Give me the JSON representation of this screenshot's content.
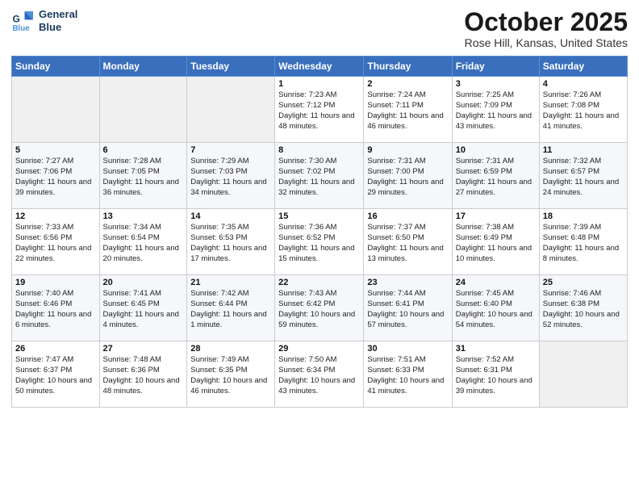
{
  "header": {
    "logo_line1": "General",
    "logo_line2": "Blue",
    "month": "October 2025",
    "location": "Rose Hill, Kansas, United States"
  },
  "days_of_week": [
    "Sunday",
    "Monday",
    "Tuesday",
    "Wednesday",
    "Thursday",
    "Friday",
    "Saturday"
  ],
  "weeks": [
    [
      {
        "day": "",
        "sunrise": "",
        "sunset": "",
        "daylight": ""
      },
      {
        "day": "",
        "sunrise": "",
        "sunset": "",
        "daylight": ""
      },
      {
        "day": "",
        "sunrise": "",
        "sunset": "",
        "daylight": ""
      },
      {
        "day": "1",
        "sunrise": "7:23 AM",
        "sunset": "7:12 PM",
        "daylight": "11 hours and 48 minutes."
      },
      {
        "day": "2",
        "sunrise": "7:24 AM",
        "sunset": "7:11 PM",
        "daylight": "11 hours and 46 minutes."
      },
      {
        "day": "3",
        "sunrise": "7:25 AM",
        "sunset": "7:09 PM",
        "daylight": "11 hours and 43 minutes."
      },
      {
        "day": "4",
        "sunrise": "7:26 AM",
        "sunset": "7:08 PM",
        "daylight": "11 hours and 41 minutes."
      }
    ],
    [
      {
        "day": "5",
        "sunrise": "7:27 AM",
        "sunset": "7:06 PM",
        "daylight": "11 hours and 39 minutes."
      },
      {
        "day": "6",
        "sunrise": "7:28 AM",
        "sunset": "7:05 PM",
        "daylight": "11 hours and 36 minutes."
      },
      {
        "day": "7",
        "sunrise": "7:29 AM",
        "sunset": "7:03 PM",
        "daylight": "11 hours and 34 minutes."
      },
      {
        "day": "8",
        "sunrise": "7:30 AM",
        "sunset": "7:02 PM",
        "daylight": "11 hours and 32 minutes."
      },
      {
        "day": "9",
        "sunrise": "7:31 AM",
        "sunset": "7:00 PM",
        "daylight": "11 hours and 29 minutes."
      },
      {
        "day": "10",
        "sunrise": "7:31 AM",
        "sunset": "6:59 PM",
        "daylight": "11 hours and 27 minutes."
      },
      {
        "day": "11",
        "sunrise": "7:32 AM",
        "sunset": "6:57 PM",
        "daylight": "11 hours and 24 minutes."
      }
    ],
    [
      {
        "day": "12",
        "sunrise": "7:33 AM",
        "sunset": "6:56 PM",
        "daylight": "11 hours and 22 minutes."
      },
      {
        "day": "13",
        "sunrise": "7:34 AM",
        "sunset": "6:54 PM",
        "daylight": "11 hours and 20 minutes."
      },
      {
        "day": "14",
        "sunrise": "7:35 AM",
        "sunset": "6:53 PM",
        "daylight": "11 hours and 17 minutes."
      },
      {
        "day": "15",
        "sunrise": "7:36 AM",
        "sunset": "6:52 PM",
        "daylight": "11 hours and 15 minutes."
      },
      {
        "day": "16",
        "sunrise": "7:37 AM",
        "sunset": "6:50 PM",
        "daylight": "11 hours and 13 minutes."
      },
      {
        "day": "17",
        "sunrise": "7:38 AM",
        "sunset": "6:49 PM",
        "daylight": "11 hours and 10 minutes."
      },
      {
        "day": "18",
        "sunrise": "7:39 AM",
        "sunset": "6:48 PM",
        "daylight": "11 hours and 8 minutes."
      }
    ],
    [
      {
        "day": "19",
        "sunrise": "7:40 AM",
        "sunset": "6:46 PM",
        "daylight": "11 hours and 6 minutes."
      },
      {
        "day": "20",
        "sunrise": "7:41 AM",
        "sunset": "6:45 PM",
        "daylight": "11 hours and 4 minutes."
      },
      {
        "day": "21",
        "sunrise": "7:42 AM",
        "sunset": "6:44 PM",
        "daylight": "11 hours and 1 minute."
      },
      {
        "day": "22",
        "sunrise": "7:43 AM",
        "sunset": "6:42 PM",
        "daylight": "10 hours and 59 minutes."
      },
      {
        "day": "23",
        "sunrise": "7:44 AM",
        "sunset": "6:41 PM",
        "daylight": "10 hours and 57 minutes."
      },
      {
        "day": "24",
        "sunrise": "7:45 AM",
        "sunset": "6:40 PM",
        "daylight": "10 hours and 54 minutes."
      },
      {
        "day": "25",
        "sunrise": "7:46 AM",
        "sunset": "6:38 PM",
        "daylight": "10 hours and 52 minutes."
      }
    ],
    [
      {
        "day": "26",
        "sunrise": "7:47 AM",
        "sunset": "6:37 PM",
        "daylight": "10 hours and 50 minutes."
      },
      {
        "day": "27",
        "sunrise": "7:48 AM",
        "sunset": "6:36 PM",
        "daylight": "10 hours and 48 minutes."
      },
      {
        "day": "28",
        "sunrise": "7:49 AM",
        "sunset": "6:35 PM",
        "daylight": "10 hours and 46 minutes."
      },
      {
        "day": "29",
        "sunrise": "7:50 AM",
        "sunset": "6:34 PM",
        "daylight": "10 hours and 43 minutes."
      },
      {
        "day": "30",
        "sunrise": "7:51 AM",
        "sunset": "6:33 PM",
        "daylight": "10 hours and 41 minutes."
      },
      {
        "day": "31",
        "sunrise": "7:52 AM",
        "sunset": "6:31 PM",
        "daylight": "10 hours and 39 minutes."
      },
      {
        "day": "",
        "sunrise": "",
        "sunset": "",
        "daylight": ""
      }
    ]
  ]
}
